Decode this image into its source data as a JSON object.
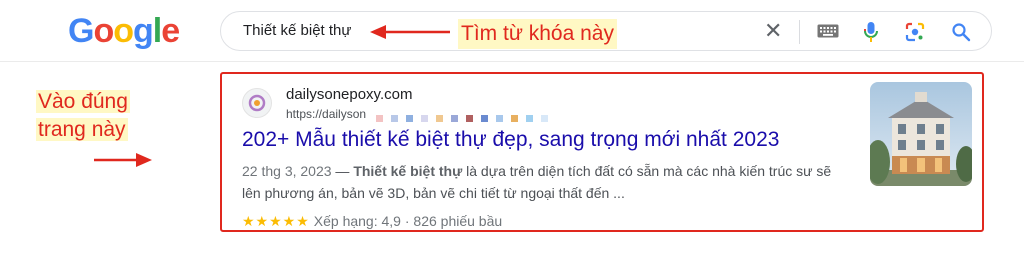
{
  "logo": {
    "letters": [
      "G",
      "o",
      "o",
      "g",
      "l",
      "e"
    ]
  },
  "search": {
    "query": "Thiết kế biệt thự",
    "clear_icon": "close-icon",
    "keyboard_icon": "keyboard-icon",
    "mic_icon": "microphone-icon",
    "lens_icon": "camera-lens-icon",
    "search_icon": "search-icon"
  },
  "annotations": {
    "find_keyword": "Tìm từ khóa này",
    "go_to_page_line1": "Vào đúng",
    "go_to_page_line2": "trang này",
    "color": "#e0281e",
    "highlight": "#fff8c4"
  },
  "result": {
    "site_name": "dailysonepoxy.com",
    "url": "https://dailyson",
    "title": "202+ Mẫu thiết kế biệt thự đẹp, sang trọng mới nhất 2023",
    "date": "22 thg 3, 2023",
    "date_sep": " — ",
    "snippet_bold": "Thiết kế biệt thự",
    "snippet_rest": " là dựa trên diện tích đất có sẵn mà các nhà kiến trúc sư sẽ lên phương án, bản vẽ 3D, bản vẽ chi tiết từ ngoại thất đến ...",
    "stars": "★★★★★",
    "rating_label": "Xếp hạng: 4,9",
    "rating_sep": " · ",
    "votes": "826 phiếu bầu",
    "rating_value": 4.9,
    "title_color": "#1a0dab"
  }
}
